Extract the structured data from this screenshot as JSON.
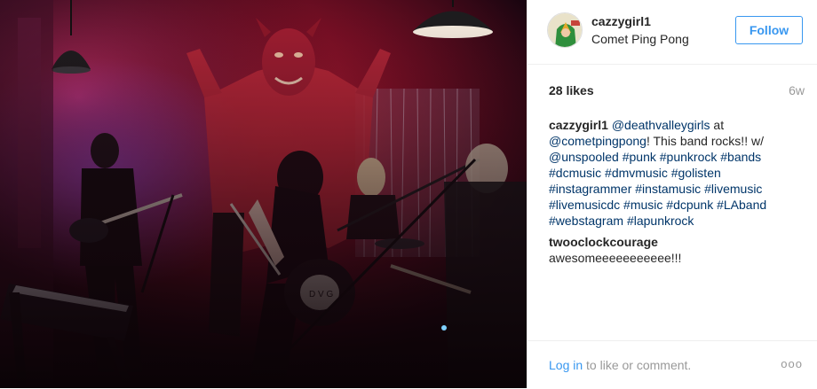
{
  "post": {
    "username": "cazzygirl1",
    "location": "Comet Ping Pong",
    "follow_label": "Follow",
    "likes": "28 likes",
    "age": "6w",
    "caption": {
      "username": "cazzygirl1",
      "parts": [
        {
          "t": " ",
          "link": false
        },
        {
          "t": "@deathvalleygirls",
          "link": true
        },
        {
          "t": " at ",
          "link": false
        },
        {
          "t": "@cometpingpong",
          "link": true
        },
        {
          "t": "! This band rocks!! w/ ",
          "link": false
        },
        {
          "t": "@unspooled",
          "link": true
        },
        {
          "t": " ",
          "link": false
        },
        {
          "t": "#punk",
          "link": true
        },
        {
          "t": " ",
          "link": false
        },
        {
          "t": "#punkrock",
          "link": true
        },
        {
          "t": " ",
          "link": false
        },
        {
          "t": "#bands",
          "link": true
        },
        {
          "t": " ",
          "link": false
        },
        {
          "t": "#dcmusic",
          "link": true
        },
        {
          "t": " ",
          "link": false
        },
        {
          "t": "#dmvmusic",
          "link": true
        },
        {
          "t": " ",
          "link": false
        },
        {
          "t": "#golisten",
          "link": true
        },
        {
          "t": " ",
          "link": false
        },
        {
          "t": "#instagrammer",
          "link": true
        },
        {
          "t": " ",
          "link": false
        },
        {
          "t": "#instamusic",
          "link": true
        },
        {
          "t": " ",
          "link": false
        },
        {
          "t": "#livemusic",
          "link": true
        },
        {
          "t": " ",
          "link": false
        },
        {
          "t": "#livemusicdc",
          "link": true
        },
        {
          "t": " ",
          "link": false
        },
        {
          "t": "#music",
          "link": true
        },
        {
          "t": " ",
          "link": false
        },
        {
          "t": "#dcpunk",
          "link": true
        },
        {
          "t": " ",
          "link": false
        },
        {
          "t": "#LAband",
          "link": true
        },
        {
          "t": " ",
          "link": false
        },
        {
          "t": "#webstagram",
          "link": true
        },
        {
          "t": " ",
          "link": false
        },
        {
          "t": "#lapunkrock",
          "link": true
        }
      ]
    },
    "comment": {
      "username": "twooclockcourage",
      "text": " awesomeeeeeeeeeee!!!"
    },
    "footer": {
      "login_link": "Log in",
      "login_rest": " to like or comment.",
      "more_label": "ooo"
    }
  },
  "colors": {
    "link": "#003569",
    "follow": "#3897f0",
    "muted": "#999999"
  }
}
